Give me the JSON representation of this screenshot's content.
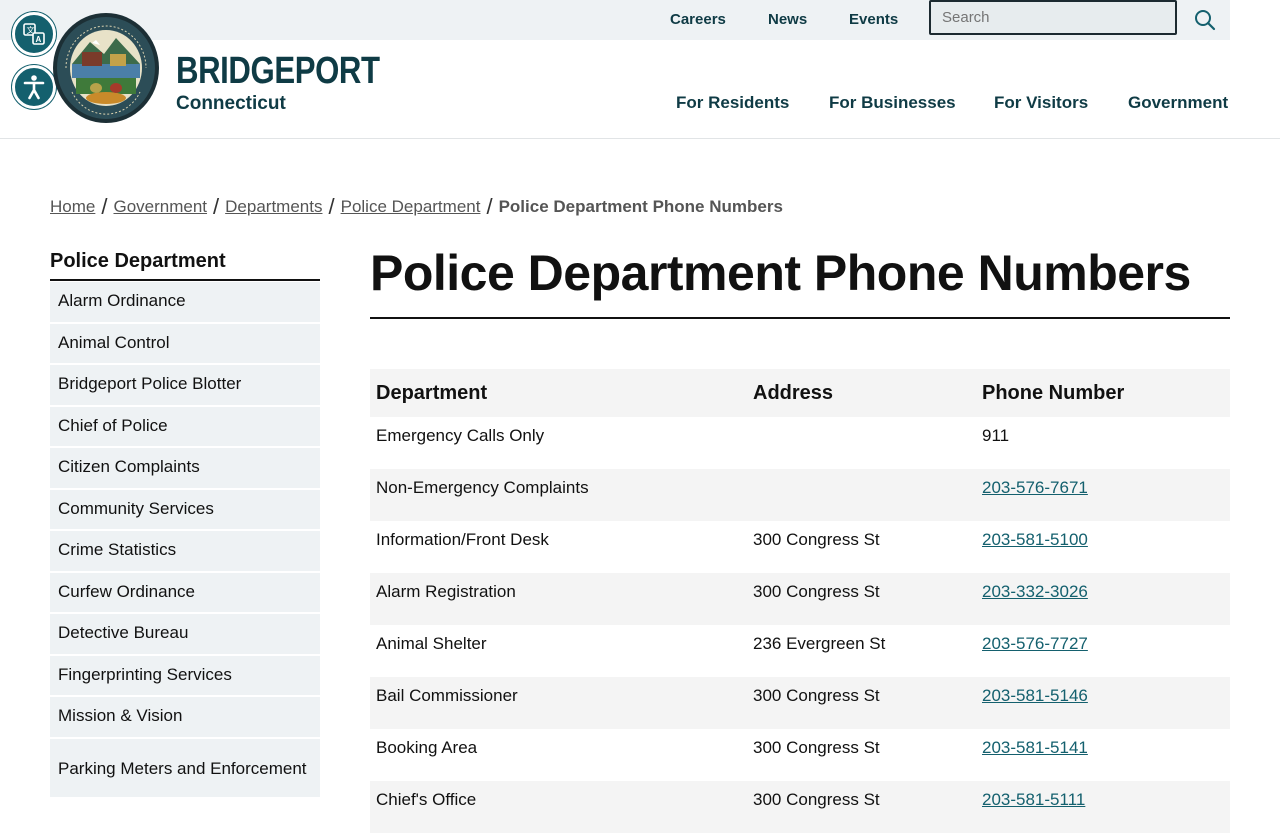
{
  "utility": {
    "links": [
      "Careers",
      "News",
      "Events"
    ],
    "search_placeholder": "Search"
  },
  "header": {
    "brand_title": "BRIDGEPORT",
    "brand_subtitle": "Connecticut",
    "accessibility_buttons": [
      "translate-icon",
      "accessibility-icon"
    ],
    "nav": [
      "For Residents",
      "For Businesses",
      "For Visitors",
      "Government"
    ]
  },
  "breadcrumb": {
    "items": [
      "Home",
      "Government",
      "Departments",
      "Police Department"
    ],
    "current": "Police Department Phone Numbers"
  },
  "sidebar": {
    "title": "Police Department",
    "items": [
      "Alarm Ordinance",
      "Animal Control",
      "Bridgeport Police Blotter",
      "Chief of Police",
      "Citizen Complaints",
      "Community Services",
      "Crime Statistics",
      "Curfew Ordinance",
      "Detective Bureau",
      "Fingerprinting Services",
      "Mission & Vision",
      "Parking Meters and Enforcement"
    ]
  },
  "main": {
    "title": "Police Department Phone Numbers",
    "table": {
      "headers": [
        "Department",
        "Address",
        "Phone Number"
      ],
      "rows": [
        {
          "department": "Emergency Calls Only",
          "address": "",
          "phone": "911",
          "phone_link": false
        },
        {
          "department": "Non-Emergency Complaints",
          "address": "",
          "phone": "203-576-7671",
          "phone_link": true
        },
        {
          "department": "Information/Front Desk",
          "address": "300 Congress St",
          "phone": "203-581-5100",
          "phone_link": true
        },
        {
          "department": "Alarm Registration",
          "address": "300 Congress St",
          "phone": "203-332-3026",
          "phone_link": true
        },
        {
          "department": "Animal Shelter",
          "address": "236 Evergreen St",
          "phone": "203-576-7727",
          "phone_link": true
        },
        {
          "department": "Bail Commissioner",
          "address": "300 Congress St",
          "phone": "203-581-5146",
          "phone_link": true
        },
        {
          "department": "Booking Area",
          "address": "300 Congress St",
          "phone": "203-581-5141",
          "phone_link": true
        },
        {
          "department": "Chief's Office",
          "address": "300 Congress St",
          "phone": "203-581-5111",
          "phone_link": true
        }
      ]
    }
  },
  "colors": {
    "brand": "#0f3b45",
    "accent": "#14606e",
    "utility_bg": "#eef2f4"
  }
}
